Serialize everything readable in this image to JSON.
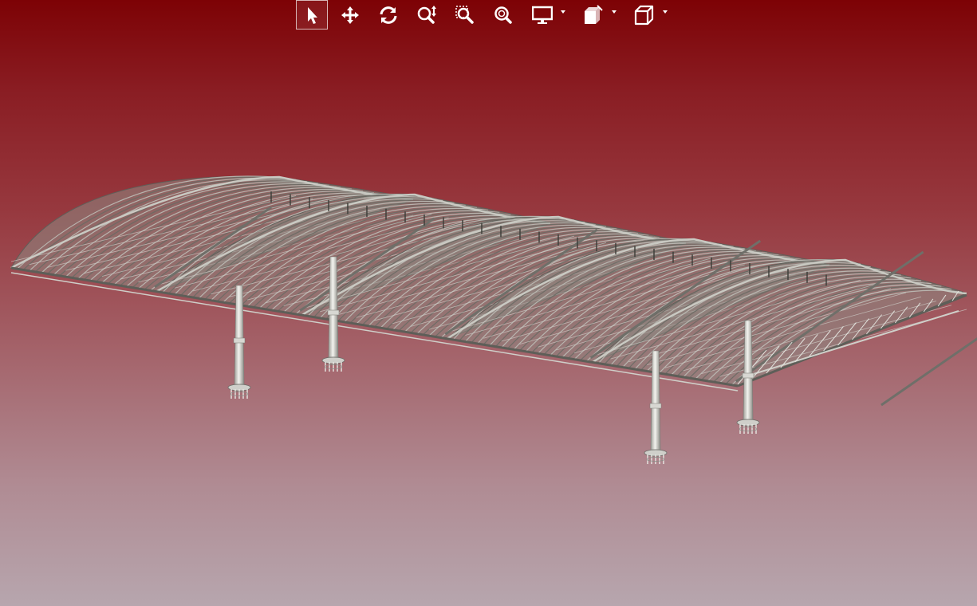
{
  "app": {
    "accent_color": "#7d0205",
    "background_top": "#7d0205",
    "background_bottom": "#b7a6ae"
  },
  "toolbar": {
    "tools": [
      {
        "id": "select",
        "icon": "arrow-cursor-icon",
        "active": true
      },
      {
        "id": "pan",
        "icon": "move-arrows-icon",
        "active": false
      },
      {
        "id": "rotate",
        "icon": "rotate-icon",
        "active": false
      },
      {
        "id": "zoom",
        "icon": "zoom-vertical-icon",
        "active": false
      },
      {
        "id": "zoom-window",
        "icon": "zoom-window-icon",
        "active": false
      },
      {
        "id": "zoom-fit",
        "icon": "zoom-fit-icon",
        "active": false
      },
      {
        "id": "display-mode",
        "icon": "monitor-icon",
        "dropdown": true
      },
      {
        "id": "section",
        "icon": "section-box-icon",
        "dropdown": true
      },
      {
        "id": "view-cube",
        "icon": "cube-icon",
        "dropdown": true
      }
    ]
  },
  "model": {
    "description_icon": "steel-canopy-model",
    "structure_color": "#8f8f87",
    "column_color": "#d8d8d4",
    "bays": 5,
    "columns": 4
  }
}
